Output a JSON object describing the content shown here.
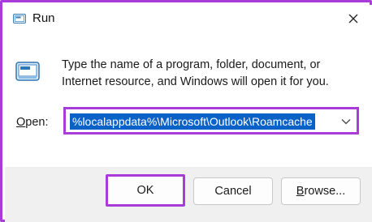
{
  "window": {
    "title": "Run",
    "title_icon": "run-icon",
    "close_icon": "close-icon"
  },
  "content": {
    "icon": "run-icon",
    "description": "Type the name of a program, folder, document, or Internet resource, and Windows will open it for you."
  },
  "open_field": {
    "label_accel": "O",
    "label_rest": "pen:",
    "value": "%localappdata%\\Microsoft\\Outlook\\Roamcache",
    "dropdown_icon": "chevron-down-icon"
  },
  "buttons": {
    "ok": "OK",
    "cancel": "Cancel",
    "browse_accel": "B",
    "browse_rest": "rowse..."
  },
  "colors": {
    "highlight_border": "#a93bd8",
    "selection": "#0a62c8"
  }
}
